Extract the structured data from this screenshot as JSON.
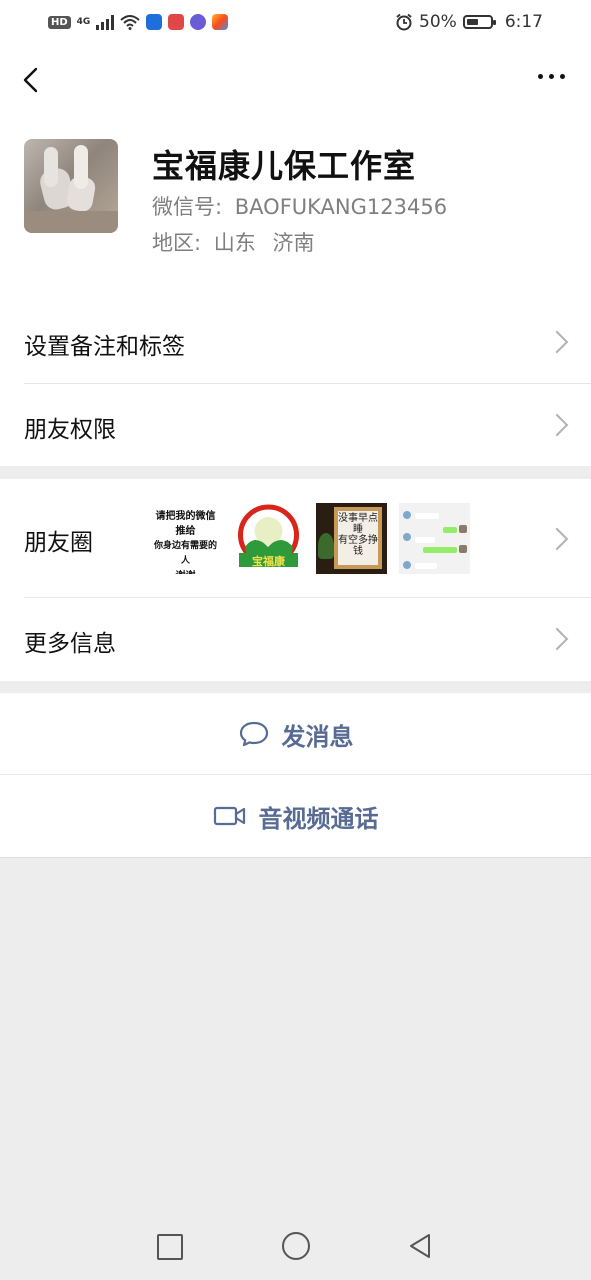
{
  "status_bar": {
    "left_badges": [
      "HD",
      "4G"
    ],
    "battery_percent_text": "50%",
    "battery_level": 0.5,
    "time": "6:17",
    "icons": [
      "signal-icon",
      "wifi-icon",
      "app-icon-blue",
      "app-icon-red",
      "app-icon-purple",
      "app-icon-multicolor",
      "alarm-icon",
      "battery-icon"
    ]
  },
  "top_nav": {
    "back_icon": "chevron-left-icon",
    "more_icon": "more-dots-icon"
  },
  "profile": {
    "name": "宝福康儿保工作室",
    "wechat_id_label": "微信号:",
    "wechat_id": "BAOFUKANG123456",
    "region_label": "地区:",
    "region_province": "山东",
    "region_city": "济南"
  },
  "menu": {
    "remarks_tags": "设置备注和标签",
    "friend_permissions": "朋友权限",
    "moments": "朋友圈",
    "more_info": "更多信息"
  },
  "moments_thumbs": {
    "t1_lines": [
      "请把我的微信",
      "推给",
      "你身边有需要的人",
      "谢谢"
    ],
    "t2_logo_text": "宝福康",
    "t3_poem": [
      "没事早点睡",
      "有空多挣钱"
    ]
  },
  "actions": {
    "send_message": "发消息",
    "audio_video_call": "音视频通话"
  },
  "colors": {
    "accent_link": "#576b95",
    "background": "#ededed"
  }
}
